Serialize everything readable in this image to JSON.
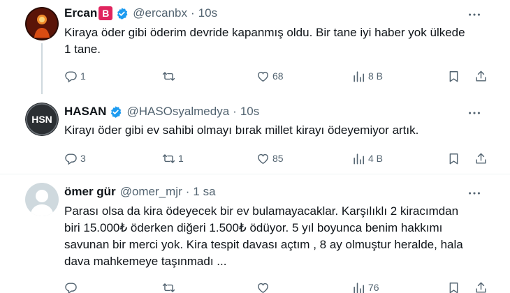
{
  "tweets": [
    {
      "name": "Ercan",
      "badge": "B",
      "handle": "@ercanbx",
      "dot": "·",
      "time": "10s",
      "text_lines": [
        "Kiraya öder gibi öderim devride kapanmış oldu. Bir tane iyi haber yok ülkede",
        "1 tane."
      ],
      "replies": "1",
      "retweets": "",
      "likes": "68",
      "views": "8 B",
      "verified": true
    },
    {
      "name": "HASAN",
      "avatar_text": "HSN",
      "handle": "@HASOsyalmedya",
      "dot": "·",
      "time": "10s",
      "text_lines": [
        "Kirayı öder gibi ev sahibi olmayı bırak millet kirayı ödeyemiyor artık."
      ],
      "replies": "3",
      "retweets": "1",
      "likes": "85",
      "views": "4 B",
      "verified": true
    },
    {
      "name": "ömer gür",
      "handle": "@omer_mjr",
      "dot": "·",
      "time": "1 sa",
      "text_lines": [
        "Parası olsa da kira ödeyecek bir ev bulamayacaklar. Karşılıklı 2 kiracımdan",
        "biri 15.000₺ öderken diğeri 1.500₺ ödüyor. 5 yıl boyunca benim hakkımı",
        "savunan bir merci yok. Kira tespit davası açtım , 8 ay olmuştur heralde, hala",
        "dava mahkemeye taşınmadı ..."
      ],
      "replies": "",
      "retweets": "",
      "likes": "",
      "views": "76",
      "verified": false
    }
  ],
  "colors": {
    "text": "#0f1419",
    "secondary": "#536471",
    "verified": "#1d9bf0",
    "badge": "#e0245e",
    "divider": "#eff3f4",
    "thread_line": "#cfd9de"
  },
  "icons": [
    "reply-icon",
    "retweet-icon",
    "like-icon",
    "views-icon",
    "bookmark-icon",
    "share-icon",
    "more-icon",
    "verified-icon"
  ]
}
